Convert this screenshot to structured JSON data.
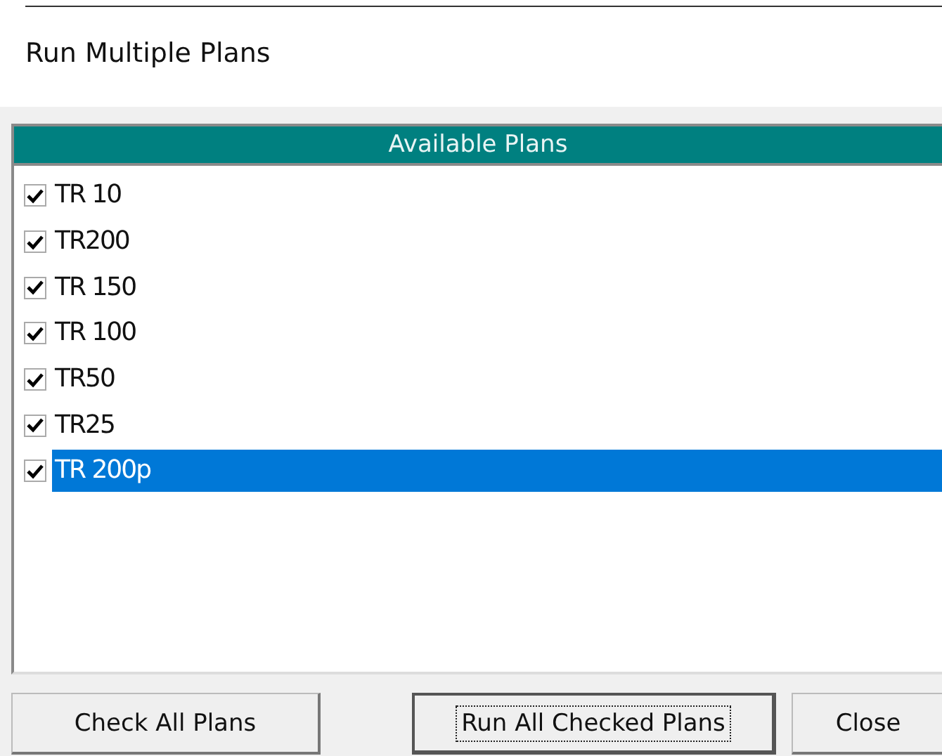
{
  "window": {
    "title": "Run Multiple Plans"
  },
  "list": {
    "header": "Available Plans",
    "items": [
      {
        "label": "TR 10",
        "checked": true,
        "selected": false
      },
      {
        "label": "TR200",
        "checked": true,
        "selected": false
      },
      {
        "label": "TR 150",
        "checked": true,
        "selected": false
      },
      {
        "label": "TR 100",
        "checked": true,
        "selected": false
      },
      {
        "label": "TR50",
        "checked": true,
        "selected": false
      },
      {
        "label": "TR25",
        "checked": true,
        "selected": false
      },
      {
        "label": "TR 200p",
        "checked": true,
        "selected": true
      }
    ]
  },
  "buttons": [
    {
      "label": "Check All Plans",
      "focused": false
    },
    {
      "label": "Run All Checked Plans",
      "focused": true
    },
    {
      "label": "Close",
      "focused": false
    }
  ]
}
